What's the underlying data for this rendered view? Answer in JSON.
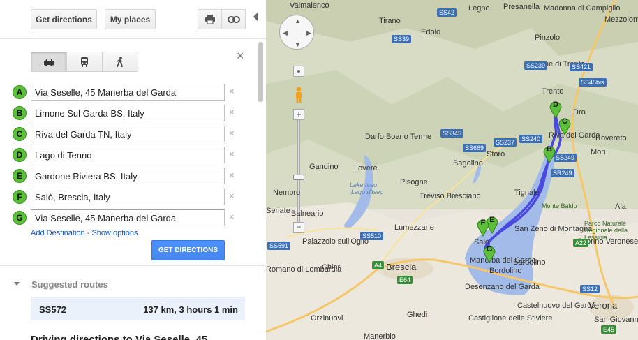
{
  "toolbar": {
    "get_directions_label": "Get directions",
    "my_places_label": "My places",
    "print_icon": "printer-icon",
    "link_icon": "link-icon"
  },
  "modes": [
    "car-icon",
    "transit-icon",
    "walk-icon"
  ],
  "waypoints": [
    {
      "letter": "A",
      "value": "Via Seselle, 45 Manerba del Garda"
    },
    {
      "letter": "B",
      "value": "Limone Sul Garda BS, Italy"
    },
    {
      "letter": "C",
      "value": "Riva del Garda TN, Italy"
    },
    {
      "letter": "D",
      "value": "Lago di Tenno"
    },
    {
      "letter": "E",
      "value": "Gardone Riviera BS, Italy"
    },
    {
      "letter": "F",
      "value": "Salò, Brescia, Italy"
    },
    {
      "letter": "G",
      "value": "Via Seselle, 45 Manerba del Garda"
    }
  ],
  "links": {
    "add_destination": "Add Destination",
    "separator": "-",
    "show_options": "Show options"
  },
  "get_directions_button": "GET DIRECTIONS",
  "suggested_routes": {
    "heading": "Suggested routes",
    "route_name": "SS572",
    "route_info": "137 km, 3 hours 1 min"
  },
  "driving_heading": "Driving directions to Via Seselle, 45",
  "colors": {
    "accent": "#4d90fe",
    "marker": "#5bbf3a",
    "route": "#4a4ae0",
    "lake": "#a3bbe8"
  },
  "map": {
    "places": [
      {
        "name": "Valmalenco",
        "id": "valmalenco"
      },
      {
        "name": "Tirano",
        "id": "tirano"
      },
      {
        "name": "Legno",
        "id": "legno"
      },
      {
        "name": "Presanella",
        "id": "presanella"
      },
      {
        "name": "Madonna di Campiglio",
        "id": "campiglio"
      },
      {
        "name": "Mezzolombardo",
        "id": "mezzolombardo"
      },
      {
        "name": "Edolo",
        "id": "edolo"
      },
      {
        "name": "Pinzolo",
        "id": "pinzolo"
      },
      {
        "name": "Tione di Trento",
        "id": "tione"
      },
      {
        "name": "Trento",
        "id": "trento"
      },
      {
        "name": "Dro",
        "id": "dro"
      },
      {
        "name": "Riva del Garda",
        "id": "riva"
      },
      {
        "name": "Rovereto",
        "id": "rovereto"
      },
      {
        "name": "Darfo Boario Terme",
        "id": "darfo"
      },
      {
        "name": "Storo",
        "id": "storo"
      },
      {
        "name": "Mori",
        "id": "mori"
      },
      {
        "name": "Bagolino",
        "id": "bagolino"
      },
      {
        "name": "Gandino",
        "id": "gandino"
      },
      {
        "name": "Lovere",
        "id": "lovere"
      },
      {
        "name": "Ala",
        "id": "ala"
      },
      {
        "name": "Tignale",
        "id": "tignale"
      },
      {
        "name": "Nembro",
        "id": "nembro"
      },
      {
        "name": "Pisogne",
        "id": "pisogne"
      },
      {
        "name": "Treviso Bresciano",
        "id": "treviso"
      },
      {
        "name": "Seriate",
        "id": "seriate"
      },
      {
        "name": "Balneario",
        "id": "balneario"
      },
      {
        "name": "Lumezzane",
        "id": "lumezzane"
      },
      {
        "name": "San Zeno di Montagna",
        "id": "sanzeno"
      },
      {
        "name": "Caprino Veronese",
        "id": "caprino"
      },
      {
        "name": "Palazzolo sull'Oglio",
        "id": "palazzolo"
      },
      {
        "name": "Salò",
        "id": "salo"
      },
      {
        "name": "Chiari",
        "id": "chiari"
      },
      {
        "name": "Brescia",
        "id": "brescia"
      },
      {
        "name": "Manerba del Garda",
        "id": "manerba"
      },
      {
        "name": "Bardolino",
        "id": "bardolino"
      },
      {
        "name": "Romano di Lombardia",
        "id": "romano"
      },
      {
        "name": "Desenzano del Garda",
        "id": "desenzano"
      },
      {
        "name": "Castelnuovo del Garda",
        "id": "castelnuovo"
      },
      {
        "name": "Verona",
        "id": "verona"
      },
      {
        "name": "Orzinuovi",
        "id": "orzinuovi"
      },
      {
        "name": "Ghedi",
        "id": "ghedi"
      },
      {
        "name": "Castiglione delle Stiviere",
        "id": "castiglione"
      },
      {
        "name": "San Giovanni Lupatoto",
        "id": "sangiovanni"
      },
      {
        "name": "Manerbio",
        "id": "manerbio"
      },
      {
        "name": "Bordolino",
        "id": "bordolino"
      }
    ],
    "water_labels": [
      "Lake Iseo",
      "Lago d'Iseo"
    ],
    "park_labels": [
      "Monte Baldo",
      "Parco Naturale Regionale della Lessinia"
    ],
    "road_shields": [
      "SS42",
      "SS39",
      "SS239",
      "SS421",
      "SS45bis",
      "SS345",
      "SS240",
      "SS249",
      "SR249",
      "SS669",
      "SS237",
      "A22",
      "SS12",
      "SS510",
      "SS591",
      "A4",
      "E64",
      "E45"
    ],
    "route_markers": [
      "B",
      "C",
      "D",
      "E",
      "F",
      "G"
    ]
  }
}
